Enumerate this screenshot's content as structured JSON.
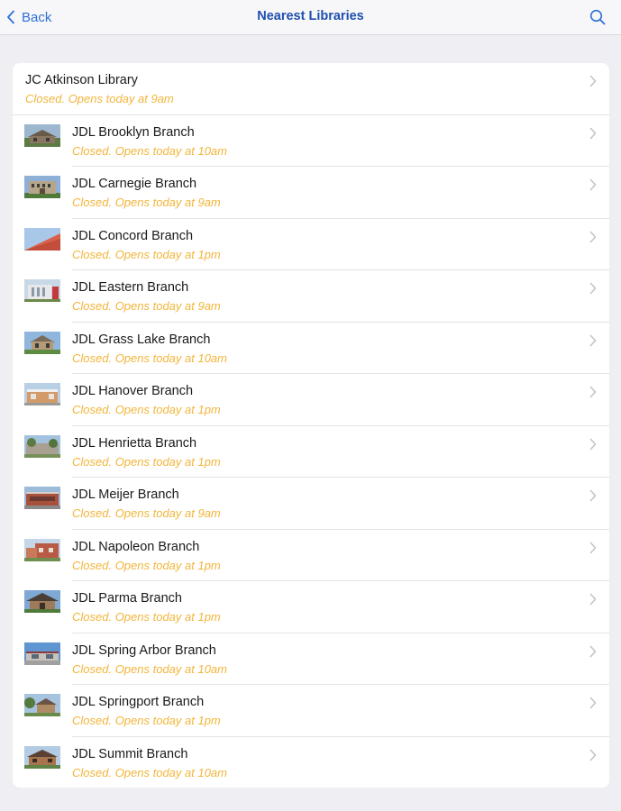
{
  "navbar": {
    "back_label": "Back",
    "title": "Nearest Libraries"
  },
  "colors": {
    "accent": "#2f6fd6",
    "title": "#1e4fae",
    "status": "#f2b53b",
    "background": "#eeeef3"
  },
  "libraries": [
    {
      "name": "JC Atkinson Library",
      "status": "Closed. Opens today at 9am",
      "has_thumbnail": false
    },
    {
      "name": "JDL Brooklyn Branch",
      "status": "Closed. Opens today at 10am",
      "has_thumbnail": true
    },
    {
      "name": "JDL Carnegie Branch",
      "status": "Closed. Opens today at 9am",
      "has_thumbnail": true
    },
    {
      "name": "JDL Concord Branch",
      "status": "Closed. Opens today at 1pm",
      "has_thumbnail": true
    },
    {
      "name": "JDL Eastern Branch",
      "status": "Closed. Opens today at 9am",
      "has_thumbnail": true
    },
    {
      "name": "JDL Grass Lake Branch",
      "status": "Closed. Opens today at 10am",
      "has_thumbnail": true
    },
    {
      "name": "JDL Hanover Branch",
      "status": "Closed. Opens today at 1pm",
      "has_thumbnail": true
    },
    {
      "name": "JDL Henrietta Branch",
      "status": "Closed. Opens today at 1pm",
      "has_thumbnail": true
    },
    {
      "name": "JDL Meijer Branch",
      "status": "Closed. Opens today at 9am",
      "has_thumbnail": true
    },
    {
      "name": "JDL Napoleon Branch",
      "status": "Closed. Opens today at 1pm",
      "has_thumbnail": true
    },
    {
      "name": "JDL Parma Branch",
      "status": "Closed. Opens today at 1pm",
      "has_thumbnail": true
    },
    {
      "name": "JDL Spring Arbor Branch",
      "status": "Closed. Opens today at 10am",
      "has_thumbnail": true
    },
    {
      "name": "JDL Springport Branch",
      "status": "Closed. Opens today at 1pm",
      "has_thumbnail": true
    },
    {
      "name": "JDL Summit Branch",
      "status": "Closed. Opens today at 10am",
      "has_thumbnail": true
    }
  ]
}
